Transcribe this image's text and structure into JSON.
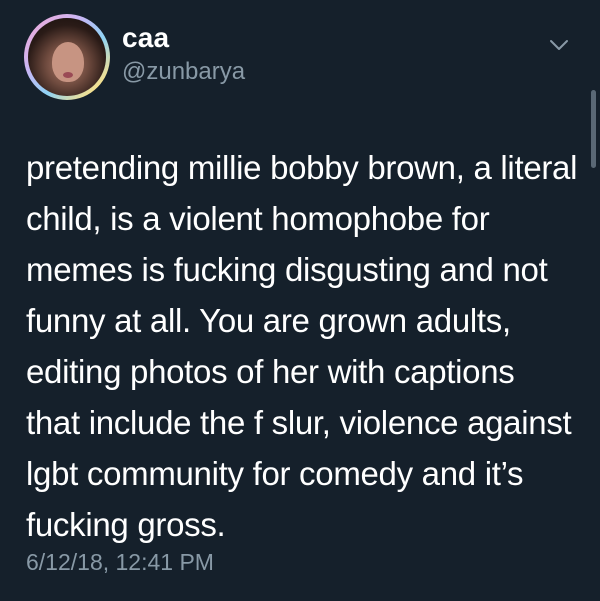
{
  "user": {
    "display_name": "caa",
    "handle": "@zunbarya",
    "avatar_icon": "avatar-photo"
  },
  "menu": {
    "icon": "chevron-down-icon"
  },
  "tweet": {
    "text": "pretending millie bobby brown, a literal\nchild, is a violent homophobe for\nmemes is fucking disgusting and not\nfunny at all. You are grown adults,\nediting photos of her with captions\nthat include the f slur, violence against\nlgbt community for comedy and it’s\nfucking gross.",
    "timestamp": "6/12/18, 12:41 PM"
  },
  "colors": {
    "background": "#15202b",
    "text_primary": "#ffffff",
    "text_secondary": "#8899a6"
  }
}
